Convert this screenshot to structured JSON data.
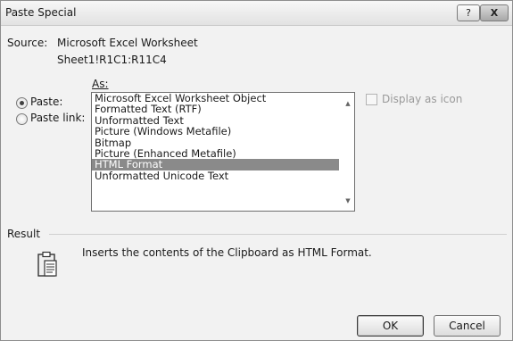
{
  "window": {
    "title": "Paste Special",
    "help_label": "?",
    "close_label": "X"
  },
  "source": {
    "label": "Source:",
    "value": "Microsoft Excel Worksheet",
    "range": "Sheet1!R1C1:R11C4"
  },
  "as_label": "As:",
  "options": {
    "paste_label": "Paste:",
    "paste_link_label": "Paste link:",
    "selected": "paste"
  },
  "formats": [
    "Microsoft Excel Worksheet Object",
    "Formatted Text (RTF)",
    "Unformatted Text",
    "Picture (Windows Metafile)",
    "Bitmap",
    "Picture (Enhanced Metafile)",
    "HTML Format",
    "Unformatted Unicode Text"
  ],
  "selected_format_index": 6,
  "display_as_icon": {
    "label": "Display as icon",
    "checked": false,
    "enabled": false
  },
  "result": {
    "label": "Result",
    "text": "Inserts the contents of the Clipboard as HTML Format.",
    "icon": "clipboard-icon"
  },
  "buttons": {
    "ok": "OK",
    "cancel": "Cancel"
  }
}
